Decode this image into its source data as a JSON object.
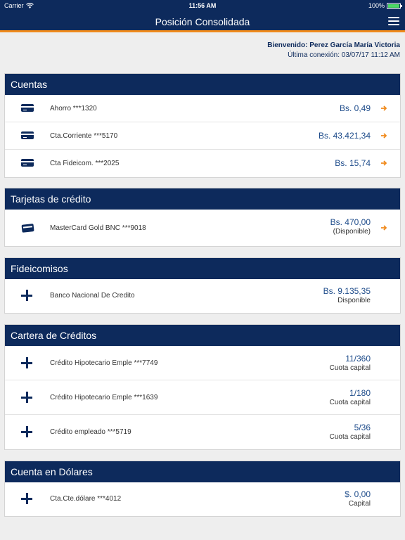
{
  "status_bar": {
    "carrier": "Carrier",
    "time": "11:56 AM",
    "battery": "100%"
  },
  "nav": {
    "title": "Posición Consolidada"
  },
  "welcome": {
    "greeting": "Bienvenido: Perez García María Victoria",
    "last_login": "Última conexión: 03/07/17 11:12 AM"
  },
  "sections": [
    {
      "title": "Cuentas",
      "items": [
        {
          "label": "Ahorro ***1320",
          "value": "Bs. 0,49"
        },
        {
          "label": "Cta.Corriente ***5170",
          "value": "Bs. 43.421,34"
        },
        {
          "label": "Cta Fideicom. ***2025",
          "value": "Bs. 15,74"
        }
      ]
    },
    {
      "title": "Tarjetas de crédito",
      "items": [
        {
          "label": "MasterCard Gold BNC ***9018",
          "value": "Bs. 470,00",
          "sub": "(Disponible)"
        }
      ]
    },
    {
      "title": "Fideicomisos",
      "items": [
        {
          "label": "Banco Nacional De Credito",
          "value": "Bs. 9.135,35",
          "sub": "Disponible"
        }
      ]
    },
    {
      "title": "Cartera de Créditos",
      "items": [
        {
          "label": "Crédito Hipotecario Emple ***7749",
          "value": "11/360",
          "sub": "Cuota capital"
        },
        {
          "label": "Crédito Hipotecario Emple ***1639",
          "value": "1/180",
          "sub": "Cuota capital"
        },
        {
          "label": "Crédito empleado ***5719",
          "value": "5/36",
          "sub": "Cuota capital"
        }
      ]
    },
    {
      "title": "Cuenta en Dólares",
      "items": [
        {
          "label": "Cta.Cte.dólare ***4012",
          "value": "$. 0,00",
          "sub": "Capital"
        }
      ]
    }
  ],
  "colors": {
    "navy": "#0d2a5c",
    "accent_orange": "#f08a1c",
    "value_blue": "#1d4b8a"
  },
  "icons": {
    "account": "card-icon",
    "credit_card": "credit-card-icon",
    "expand": "plus-icon",
    "go": "arrow-right-icon",
    "menu": "hamburger-menu-icon"
  }
}
